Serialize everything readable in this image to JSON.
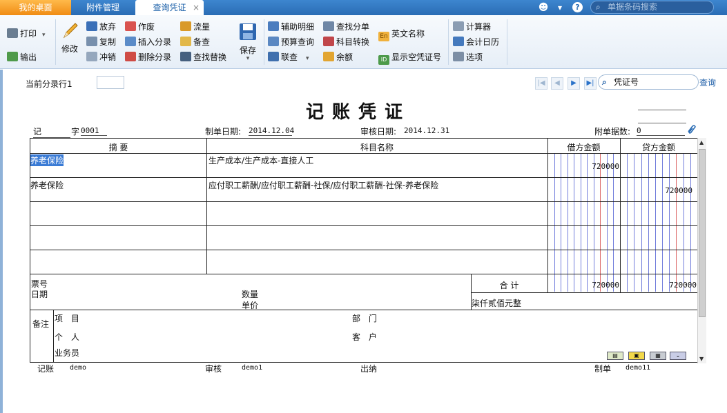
{
  "tabs": {
    "home": "我的桌面",
    "attachment": "附件管理",
    "active": "查询凭证",
    "close": "×"
  },
  "topbar": {
    "search_placeholder": "单据条码搜索",
    "smiley": "☻",
    "dropdown": "▾",
    "help": "?"
  },
  "toolbar": {
    "print": "打印",
    "export": "输出",
    "modify": "修改",
    "abandon": "放弃",
    "void": "作废",
    "flow": "流量",
    "copy": "复制",
    "insert_entry": "插入分录",
    "memo": "备查",
    "reverse": "冲销",
    "delete_entry": "删除分录",
    "find_replace": "查找替换",
    "save": "保存",
    "aux_detail": "辅助明细",
    "find_entry": "查找分单",
    "english_name": "英文名称",
    "budget_query": "预算查询",
    "subject_convert": "科目转换",
    "linked_query": "联查",
    "balance": "余额",
    "show_empty_voucher": "显示空凭证号",
    "calculator": "计算器",
    "accounting_calendar": "会计日历",
    "options": "选项"
  },
  "nav": {
    "current_entry_label": "当前分录行1",
    "search_placeholder": "凭证号",
    "query": "查询"
  },
  "voucher": {
    "title": "记账凭证",
    "type": "记",
    "number_label": "字",
    "number": "0001",
    "made_date_label": "制单日期:",
    "made_date": "2014.12.04",
    "audit_date_label": "审核日期:",
    "audit_date": "2014.12.31",
    "attachments_label": "附单据数:",
    "attachments": "0",
    "columns": {
      "summary": "摘 要",
      "subject": "科目名称",
      "debit": "借方金额",
      "credit": "贷方金额"
    },
    "rows": [
      {
        "summary": "养老保险",
        "subject": "生产成本/生产成本-直接人工",
        "debit": "720000",
        "credit": ""
      },
      {
        "summary": "养老保险",
        "subject": "应付职工薪酬/应付职工薪酬-社保/应付职工薪酬-社保-养老保险",
        "debit": "",
        "credit": "720000"
      },
      {
        "summary": "",
        "subject": "",
        "debit": "",
        "credit": ""
      },
      {
        "summary": "",
        "subject": "",
        "debit": "",
        "credit": ""
      },
      {
        "summary": "",
        "subject": "",
        "debit": "",
        "credit": ""
      }
    ],
    "footer": {
      "ticket_label": "票号",
      "date_label": "日期",
      "quantity_label": "数量",
      "unit_price_label": "单价",
      "total_label": "合 计",
      "total_debit": "720000",
      "total_credit": "720000",
      "amount_in_words": "柒仟贰佰元整",
      "remark_label": "备注",
      "project_label": "项 目",
      "department_label": "部 门",
      "person_label": "个 人",
      "customer_label": "客 户",
      "salesperson_label": "业务员"
    },
    "signatures": {
      "bookkeeper_label": "记账",
      "bookkeeper": "demo",
      "auditor_label": "审核",
      "auditor": "demo1",
      "cashier_label": "出纳",
      "cashier": "",
      "maker_label": "制单",
      "maker": "demo11"
    }
  },
  "colors": {
    "tabbar": "#2a6cb4",
    "home_tab": "#f08c14",
    "selection": "#3a7bd5",
    "debit_grid_line": "#3344cc",
    "credit_grid_line_red": "#cc2222"
  }
}
